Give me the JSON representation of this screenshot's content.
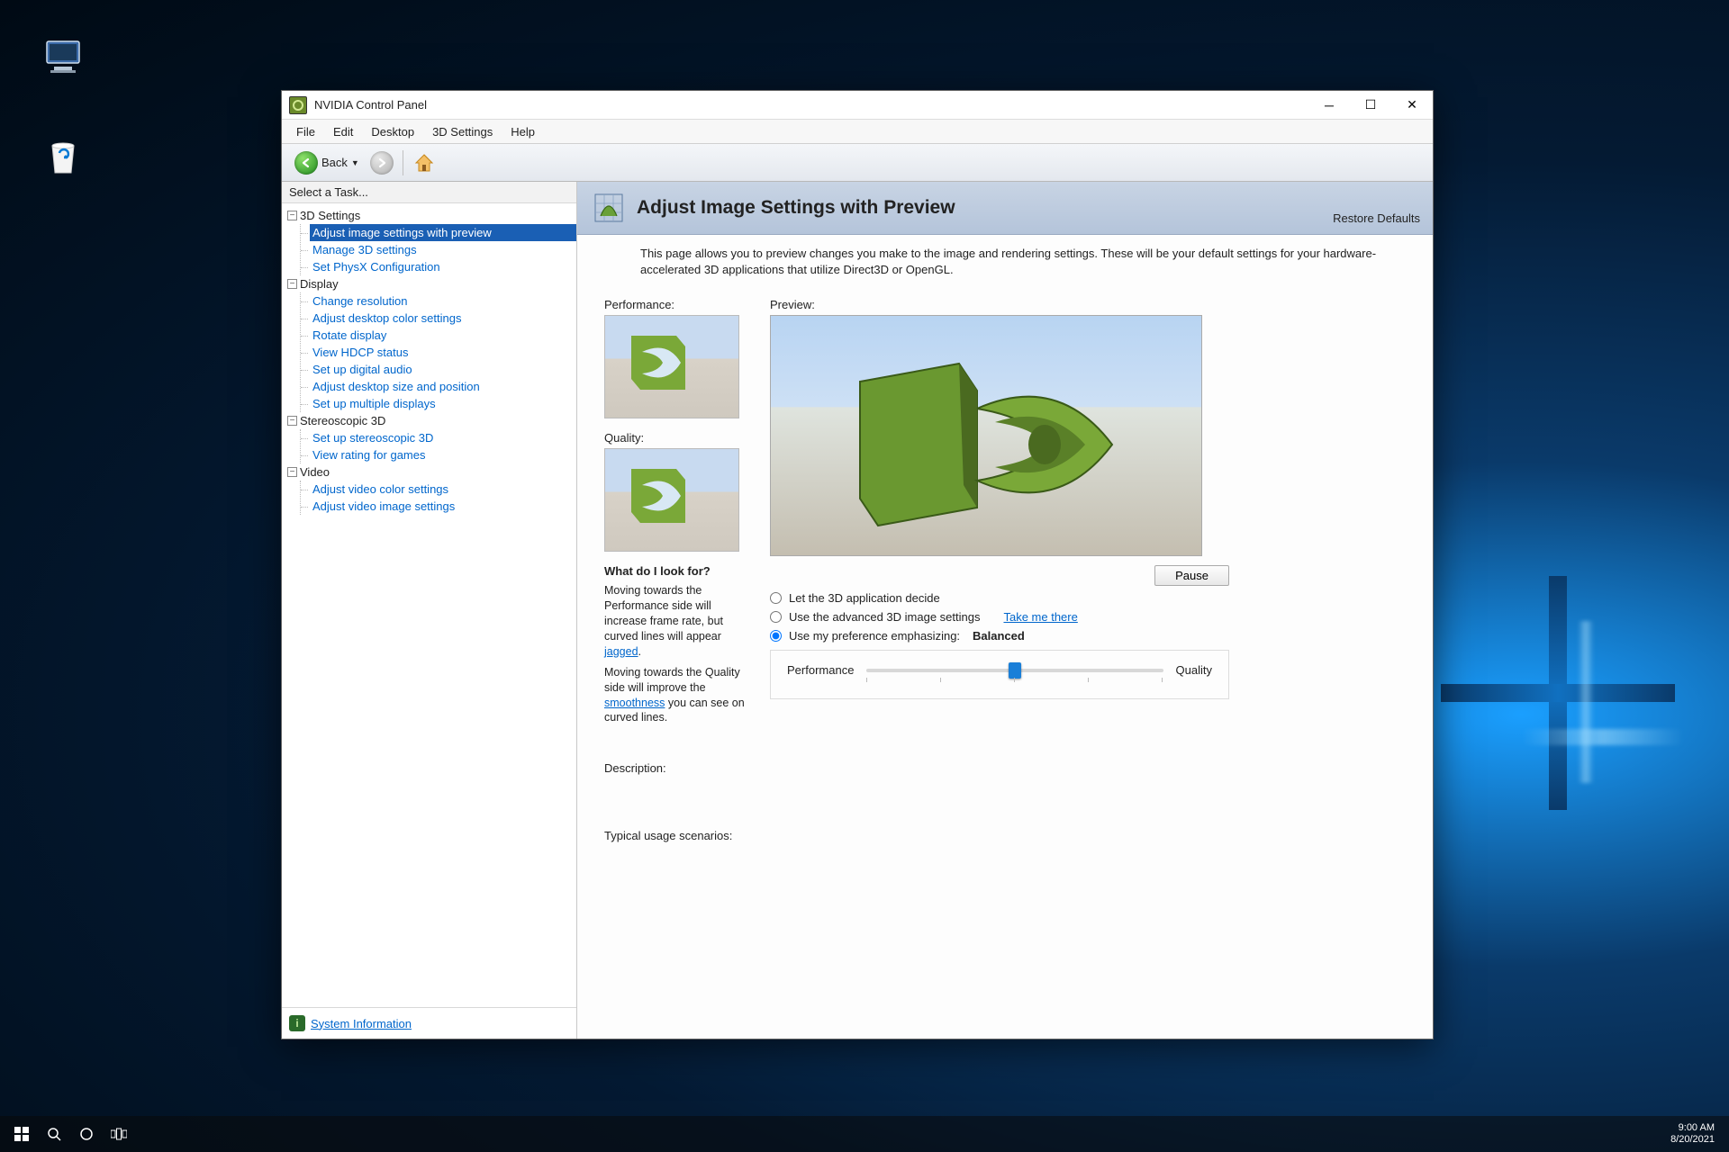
{
  "desktop": {
    "icons": {
      "pc": "This PC",
      "bin": "Recycle Bin"
    }
  },
  "taskbar": {
    "time": "9:00 AM",
    "date": "8/20/2021"
  },
  "window": {
    "title": "NVIDIA Control Panel",
    "menus": [
      "File",
      "Edit",
      "Desktop",
      "3D Settings",
      "Help"
    ],
    "toolbar": {
      "back": "Back"
    }
  },
  "sidebar": {
    "header": "Select a Task...",
    "groups": [
      {
        "label": "3D Settings",
        "items": [
          "Adjust image settings with preview",
          "Manage 3D settings",
          "Set PhysX Configuration"
        ],
        "selected": 0
      },
      {
        "label": "Display",
        "items": [
          "Change resolution",
          "Adjust desktop color settings",
          "Rotate display",
          "View HDCP status",
          "Set up digital audio",
          "Adjust desktop size and position",
          "Set up multiple displays"
        ]
      },
      {
        "label": "Stereoscopic 3D",
        "items": [
          "Set up stereoscopic 3D",
          "View rating for games"
        ]
      },
      {
        "label": "Video",
        "items": [
          "Adjust video color settings",
          "Adjust video image settings"
        ]
      }
    ],
    "footer_link": "System Information"
  },
  "main": {
    "title": "Adjust Image Settings with Preview",
    "restore": "Restore Defaults",
    "intro": "This page allows you to preview changes you make to the image and rendering settings. These will be your default settings for your hardware-accelerated 3D applications that utilize Direct3D or OpenGL.",
    "labels": {
      "performance": "Performance:",
      "quality": "Quality:",
      "preview": "Preview:"
    },
    "help": {
      "title": "What do I look for?",
      "p1a": "Moving towards the Performance side will increase frame rate, but curved lines will appear ",
      "p1link": "jagged",
      "p1b": ".",
      "p2a": "Moving towards the Quality side will improve the ",
      "p2link": "smoothness",
      "p2b": " you can see on curved lines."
    },
    "pause": "Pause",
    "radios": {
      "r1": "Let the 3D application decide",
      "r2": "Use the advanced 3D image settings",
      "r2link": "Take me there",
      "r3": "Use my preference emphasizing:",
      "r3value": "Balanced"
    },
    "slider": {
      "left": "Performance",
      "right": "Quality"
    },
    "description_label": "Description:",
    "usage_label": "Typical usage scenarios:"
  }
}
